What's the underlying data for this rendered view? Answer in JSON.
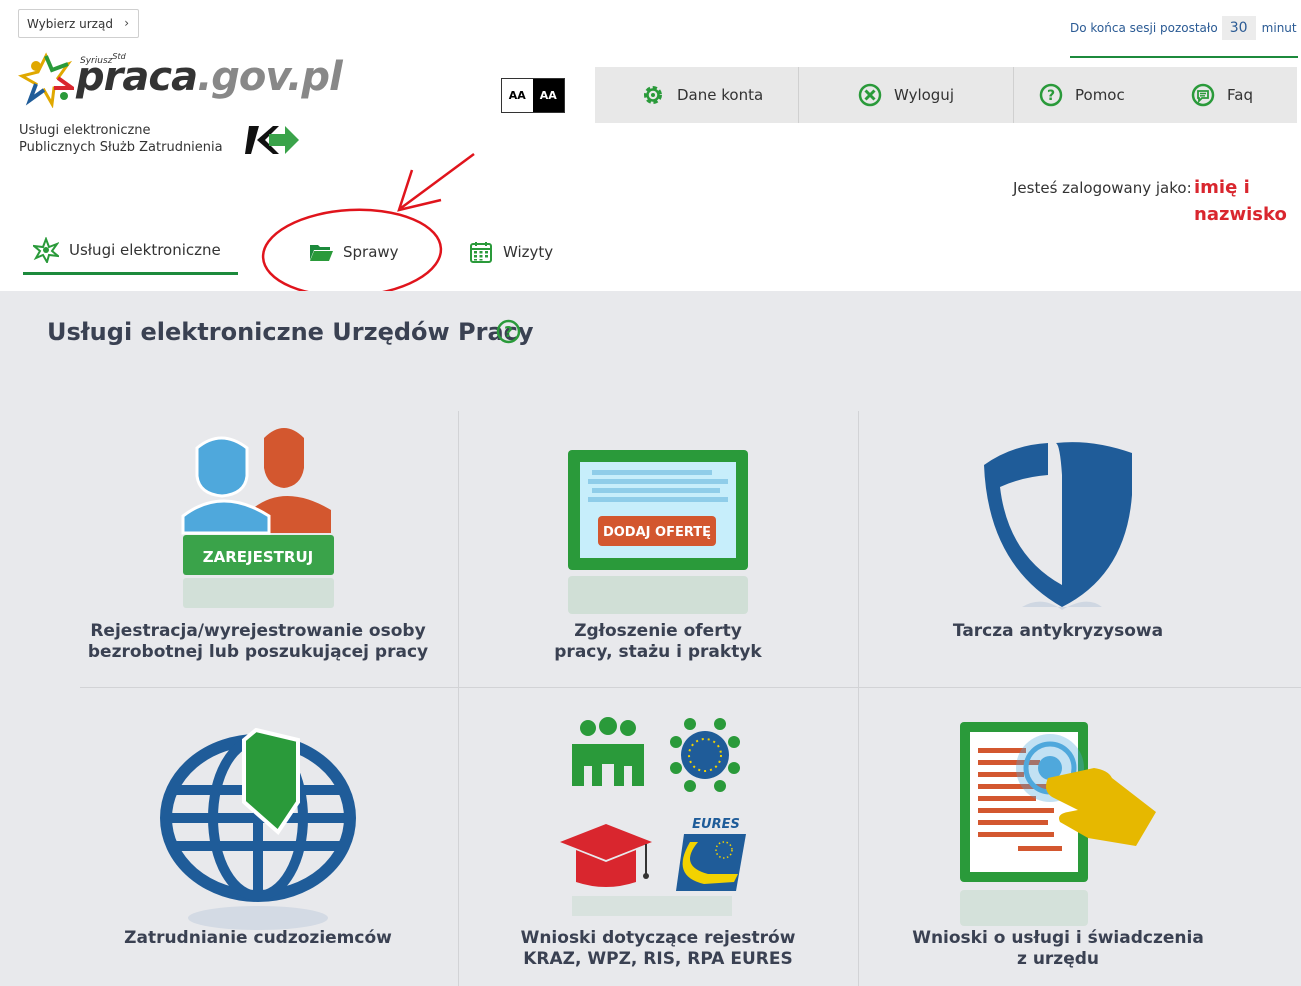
{
  "header": {
    "choose_office": "Wybierz urząd",
    "logo": {
      "super": "Syriusz",
      "super_sup": "Std",
      "name_main": "praca",
      "name_gov": ".gov.pl"
    },
    "sub_logo_line1": "Usługi elektroniczne",
    "sub_logo_line2": "Publicznych Służb Zatrudnienia",
    "contrast": {
      "normal": "AA",
      "high": "AA"
    },
    "session": {
      "prefix": "Do końca sesji pozostało",
      "minutes": "30",
      "unit": "minut"
    },
    "nav": [
      {
        "label": "Dane konta",
        "icon": "gear-icon"
      },
      {
        "label": "Wyloguj",
        "icon": "close-circle-icon"
      },
      {
        "label": "Pomoc",
        "icon": "help-icon"
      },
      {
        "label": "Faq",
        "icon": "chat-icon"
      }
    ],
    "logged_as": "Jesteś zalogowany jako:",
    "user_line1": "imię i",
    "user_line2": "nazwisko",
    "tabs": [
      {
        "label": "Usługi elektroniczne",
        "icon": "star-icon",
        "active": true
      },
      {
        "label": "Sprawy",
        "icon": "folder-icon",
        "active": false
      },
      {
        "label": "Wizyty",
        "icon": "calendar-icon",
        "active": false
      }
    ]
  },
  "main": {
    "title": "Usługi elektroniczne Urzędów Pracy",
    "tiles": [
      {
        "line1": "Rejestracja/wyrejestrowanie osoby",
        "line2": "bezrobotnej lub poszukującej pracy",
        "icon": "register-people-icon",
        "button": "ZAREJESTRUJ"
      },
      {
        "line1": "Zgłoszenie oferty",
        "line2": "pracy, stażu i praktyk",
        "icon": "job-offer-icon",
        "button": "DODAJ OFERTĘ"
      },
      {
        "line1": "Tarcza antykryzysowa",
        "line2": "",
        "icon": "shield-icon"
      },
      {
        "line1": "Zatrudnianie cudzoziemców",
        "line2": "",
        "icon": "globe-icon"
      },
      {
        "line1": "Wnioski dotyczące rejestrów",
        "line2": "KRAZ, WPZ, RIS, RPA EURES",
        "icon": "registers-icon",
        "badge": "EURES"
      },
      {
        "line1": "Wnioski o usługi i świadczenia",
        "line2": "z urzędu",
        "icon": "document-touch-icon"
      }
    ]
  },
  "colors": {
    "green": "#1c8a3c",
    "blue": "#1f5c99",
    "red": "#d9262e",
    "bg_main": "#e8e9ec"
  }
}
